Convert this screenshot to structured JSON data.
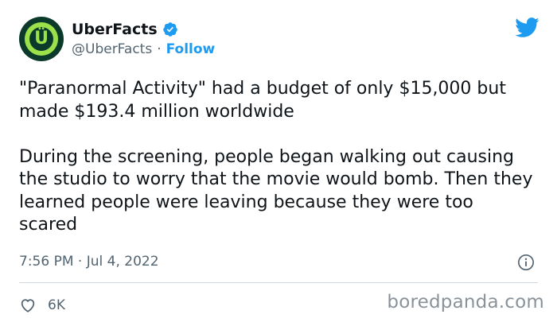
{
  "author": {
    "display_name": "UberFacts",
    "handle": "@UberFacts",
    "separator": "·",
    "follow_label": "Follow",
    "verified": true,
    "avatar_letter": "Ü",
    "avatar_colors": {
      "outer": "#0b3a2a",
      "ring": "#9be24a"
    }
  },
  "tweet": {
    "paragraphs": [
      "\"Paranormal Activity\" had a budget of only $15,000 but made $193.4 million worldwide",
      "During the screening, people began walking out causing the studio to worry that the movie would bomb. Then they learned people were leaving because they were too scared"
    ],
    "timestamp": "7:56 PM · Jul 4, 2022"
  },
  "actions": {
    "like_count": "6K",
    "like_icon": "heart-icon",
    "info_icon": "info-icon"
  },
  "brand": {
    "platform_icon": "twitter-bird-icon",
    "accent": "#1d9bf0"
  },
  "watermark": "boredpanda.com"
}
